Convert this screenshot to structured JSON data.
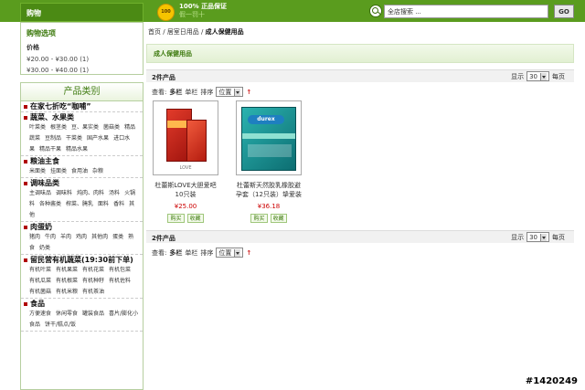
{
  "header": {
    "cart_label": "购物",
    "badge_text": "100",
    "promo_line1": "100% 正品保证",
    "promo_line2": "假一罚十",
    "search_placeholder": "全店搜索 ...",
    "search_button": "GO"
  },
  "sidebar": {
    "shop_options_title": "购物选项",
    "price_label": "价格",
    "price_ranges": [
      "¥20.00 - ¥30.00 (1)",
      "¥30.00 - ¥40.00 (1)"
    ],
    "categories_title": "产品类别",
    "groups": [
      {
        "title": "在家七折吃“咖哺”",
        "links": []
      },
      {
        "title": "蔬菜、水果类",
        "links": [
          "叶菜类",
          "根茎类",
          "豆、果实类",
          "菌菇类",
          "精品蔬菜",
          "豆制品",
          "干菜类",
          "国产水果",
          "进口水果",
          "精品干果",
          "精品水果"
        ]
      },
      {
        "title": "粮油主食",
        "links": [
          "米面类",
          "挂面类",
          "食用油",
          "杂粮"
        ]
      },
      {
        "title": "调味品类",
        "links": [
          "主调味品",
          "调味料",
          "炖肉、肉料",
          "汤料",
          "火锅料",
          "各种酱类",
          "榨菜、腌乳",
          "面料",
          "香料",
          "其他"
        ]
      },
      {
        "title": "肉蛋奶",
        "links": [
          "猪肉",
          "牛肉",
          "羊肉",
          "鸡肉",
          "其他肉",
          "蛋类",
          "熟食",
          "奶类"
        ]
      },
      {
        "title": "留民营有机蔬菜(19:30前下单)",
        "links": [
          "有机叶菜",
          "有机果菜",
          "有机花菜",
          "有机包菜",
          "有机瓜菜",
          "有机根菜",
          "有机种籽",
          "有机佐料",
          "有机菌菇",
          "有机米粮",
          "有机茶油"
        ]
      },
      {
        "title": "食品",
        "links": [
          "方便速食",
          "休闲零食",
          "罐装食品",
          "喜片/膨化小食品",
          "饼干/糕点/饭"
        ]
      }
    ]
  },
  "main": {
    "breadcrumb": [
      "首页",
      "居室日用品",
      "成人保健用品"
    ],
    "section_title": "成人保健用品",
    "product_count": "2件产品",
    "show_label": "显示",
    "per_page_value": "30",
    "per_page_suffix": "每页",
    "view_label": "查看:",
    "view_multi": "多栏",
    "view_single": "单栏",
    "sort_label": "排序",
    "sort_value": "位置",
    "sort_arrow": "↑",
    "products": [
      {
        "name": "杜蕾斯LOVE大胆爱吧 10只装",
        "price": "¥25.00",
        "buy": "购买",
        "fav": "收藏",
        "thumb_caption": "LOVE"
      },
      {
        "name": "杜蕾斯天然胶乳橡胶避孕套（12只装）挚爱装",
        "price": "¥36.18",
        "buy": "购买",
        "fav": "收藏",
        "logo": "durex"
      }
    ]
  },
  "watermark": "#1420249",
  "colors": {
    "brand_green": "#5a9c1e",
    "price_red": "#cc0000",
    "category_dot": "#b00000"
  }
}
